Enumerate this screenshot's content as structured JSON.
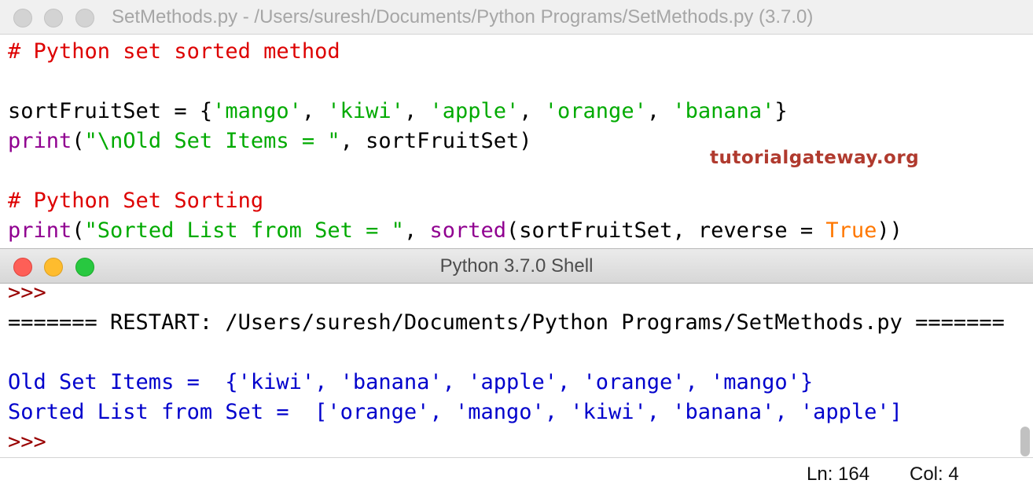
{
  "editor": {
    "title": "SetMethods.py - /Users/suresh/Documents/Python Programs/SetMethods.py (3.7.0)",
    "lines": [
      [
        {
          "cls": "comment",
          "t": "# Python set sorted method"
        }
      ],
      [],
      [
        {
          "t": "sortFruitSet = {"
        },
        {
          "cls": "string",
          "t": "'mango'"
        },
        {
          "t": ", "
        },
        {
          "cls": "string",
          "t": "'kiwi'"
        },
        {
          "t": ", "
        },
        {
          "cls": "string",
          "t": "'apple'"
        },
        {
          "t": ", "
        },
        {
          "cls": "string",
          "t": "'orange'"
        },
        {
          "t": ", "
        },
        {
          "cls": "string",
          "t": "'banana'"
        },
        {
          "t": "}"
        }
      ],
      [
        {
          "cls": "builtin",
          "t": "print"
        },
        {
          "t": "("
        },
        {
          "cls": "string",
          "t": "\"\\nOld Set Items = \""
        },
        {
          "t": ", sortFruitSet)"
        }
      ],
      [],
      [
        {
          "cls": "comment",
          "t": "# Python Set Sorting"
        }
      ],
      [
        {
          "cls": "builtin",
          "t": "print"
        },
        {
          "t": "("
        },
        {
          "cls": "string",
          "t": "\"Sorted List from Set = \""
        },
        {
          "t": ", "
        },
        {
          "cls": "builtin",
          "t": "sorted"
        },
        {
          "t": "(sortFruitSet, reverse = "
        },
        {
          "cls": "keyword",
          "t": "True"
        },
        {
          "t": "))"
        }
      ]
    ]
  },
  "watermark": "tutorialgateway.org",
  "shell": {
    "title": "Python 3.7.0 Shell",
    "lines": [
      [
        {
          "cls": "prompt",
          "t": ">>>"
        }
      ],
      [
        {
          "t": "======= RESTART: /Users/suresh/Documents/Python Programs/SetMethods.py ======="
        }
      ],
      [],
      [
        {
          "cls": "output",
          "t": "Old Set Items =  {'kiwi', 'banana', 'apple', 'orange', 'mango'}"
        }
      ],
      [
        {
          "cls": "output",
          "t": "Sorted List from Set =  ['orange', 'mango', 'kiwi', 'banana', 'apple']"
        }
      ],
      [
        {
          "cls": "prompt",
          "t": ">>>"
        }
      ]
    ],
    "status": {
      "ln": "Ln: 164",
      "col": "Col: 4"
    }
  }
}
